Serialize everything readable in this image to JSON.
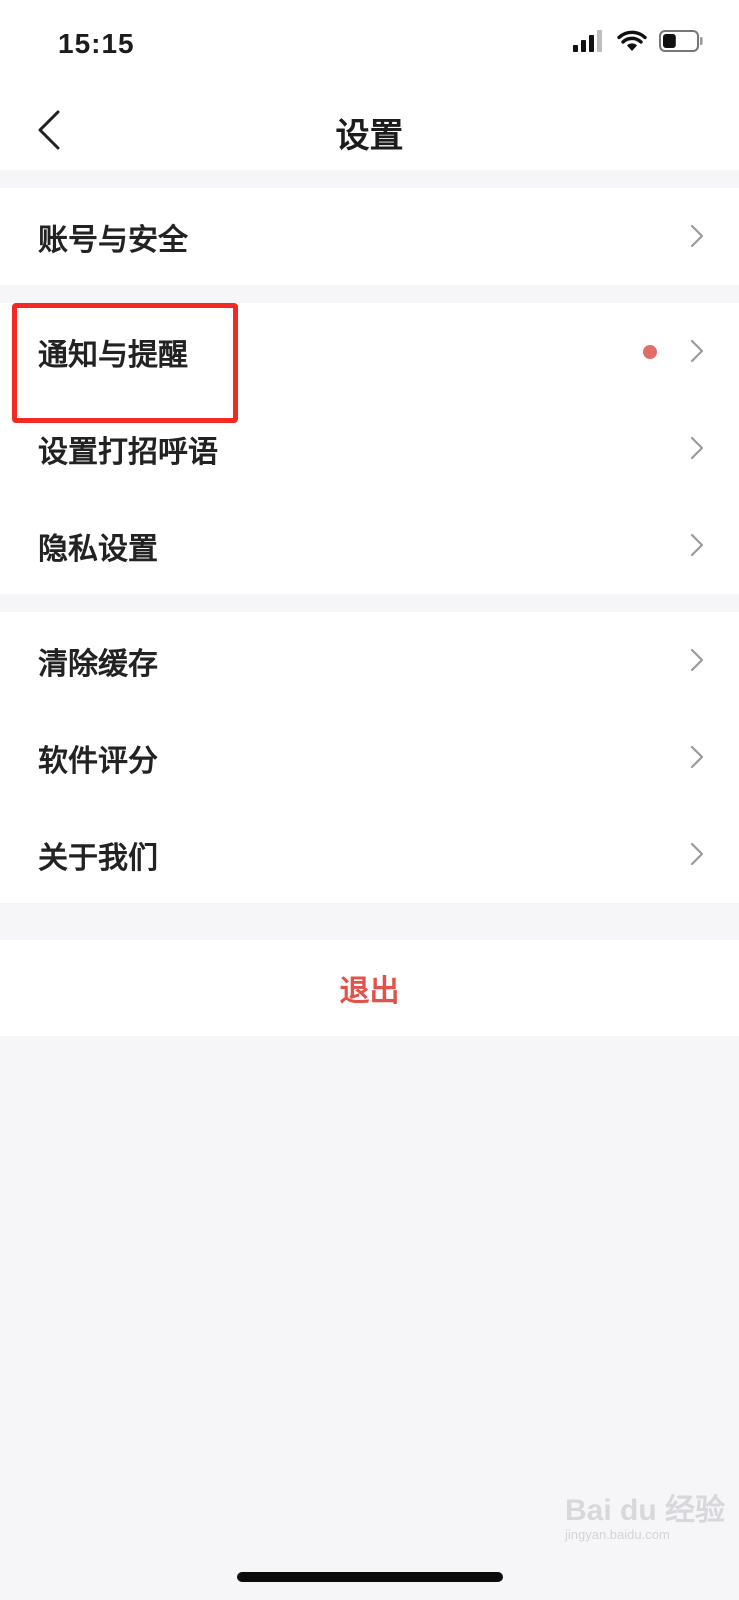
{
  "status_bar": {
    "time": "15:15",
    "icons": [
      "signal-icon",
      "wifi-icon",
      "battery-icon"
    ],
    "battery_level": 0.4
  },
  "navbar": {
    "title": "设置",
    "back_icon": "chevron-left-icon"
  },
  "groups": [
    {
      "items": [
        {
          "label": "账号与安全",
          "dot": false
        }
      ]
    },
    {
      "items": [
        {
          "label": "通知与提醒",
          "dot": true
        },
        {
          "label": "设置打招呼语",
          "dot": false
        },
        {
          "label": "隐私设置",
          "dot": false
        }
      ]
    },
    {
      "items": [
        {
          "label": "清除缓存",
          "dot": false
        },
        {
          "label": "软件评分",
          "dot": false
        },
        {
          "label": "关于我们",
          "dot": false
        }
      ]
    }
  ],
  "logout_label": "退出",
  "watermark": {
    "brand": "Bai du 经验",
    "url": "jingyan.baidu.com"
  },
  "colors": {
    "background": "#f6f6f8",
    "logout_text": "#e2514a",
    "notification_dot": "#e06d66",
    "highlight_box": "#f42a22"
  }
}
